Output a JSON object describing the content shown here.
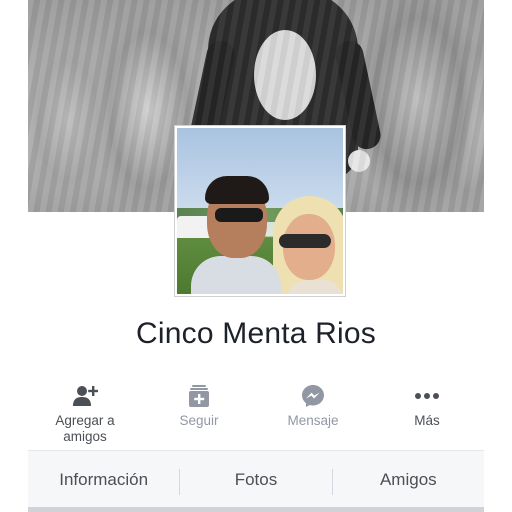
{
  "profile": {
    "name": "Cinco Menta Rios"
  },
  "actions": [
    {
      "label": "Agregar a amigos",
      "icon": "add-friend-icon",
      "enabled": true
    },
    {
      "label": "Seguir",
      "icon": "follow-icon",
      "enabled": false
    },
    {
      "label": "Mensaje",
      "icon": "messenger-icon",
      "enabled": false
    },
    {
      "label": "Más",
      "icon": "more-icon",
      "enabled": true
    }
  ],
  "tabs": [
    {
      "label": "Información"
    },
    {
      "label": "Fotos"
    },
    {
      "label": "Amigos"
    }
  ],
  "colors": {
    "text_primary": "#1d2129",
    "text_action": "#4b4f56",
    "text_muted": "#9197a3",
    "tab_bar_bg": "#f6f7f9"
  }
}
